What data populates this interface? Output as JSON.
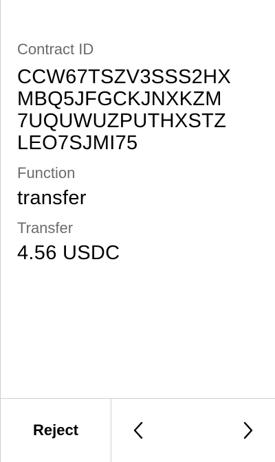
{
  "fields": {
    "contract": {
      "label": "Contract ID",
      "lines": [
        "CCW67TSZV3SSS2HX",
        "MBQ5JFGCKJNXKZM",
        "7UQUWUZPUTHXSTZ",
        "LEO7SJMI75"
      ]
    },
    "function": {
      "label": "Function",
      "value": "transfer"
    },
    "transfer": {
      "label": "Transfer",
      "value": "4.56 USDC"
    }
  },
  "footer": {
    "reject_label": "Reject",
    "prev_icon": "chevron-left-icon",
    "next_icon": "chevron-right-icon"
  }
}
